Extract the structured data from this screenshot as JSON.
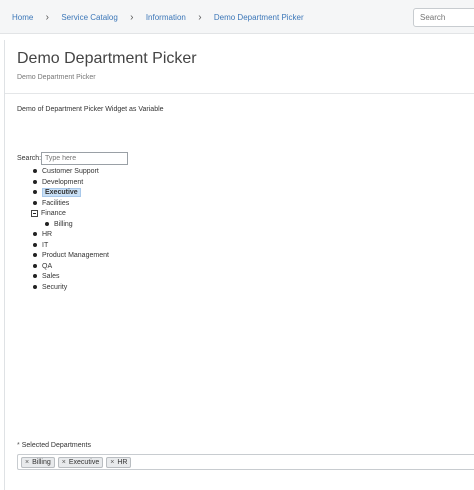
{
  "breadcrumb": {
    "items": [
      {
        "label": "Home"
      },
      {
        "label": "Service Catalog"
      },
      {
        "label": "Information"
      },
      {
        "label": "Demo Department Picker"
      }
    ],
    "separator": "›"
  },
  "header": {
    "search_placeholder": "Search"
  },
  "page": {
    "title": "Demo Department Picker",
    "subtitle": "Demo Department Picker",
    "description": "Demo of Department Picker Widget as Variable"
  },
  "picker": {
    "search_label": "Search:",
    "search_placeholder": "Type here",
    "tree": [
      {
        "label": "Customer Support"
      },
      {
        "label": "Development"
      },
      {
        "label": "Executive",
        "selected": true
      },
      {
        "label": "Facilities"
      },
      {
        "label": "Finance",
        "expanded": true,
        "children": [
          {
            "label": "Billing"
          }
        ]
      },
      {
        "label": "HR"
      },
      {
        "label": "IT"
      },
      {
        "label": "Product Management"
      },
      {
        "label": "QA"
      },
      {
        "label": "Sales"
      },
      {
        "label": "Security"
      }
    ]
  },
  "selected_departments": {
    "required_marker": "*",
    "label": "Selected Departments",
    "chips": [
      "Billing",
      "Executive",
      "HR"
    ],
    "remove_glyph": "×"
  },
  "colors": {
    "link": "#3c77b8",
    "selection": "#c9e0f6"
  }
}
